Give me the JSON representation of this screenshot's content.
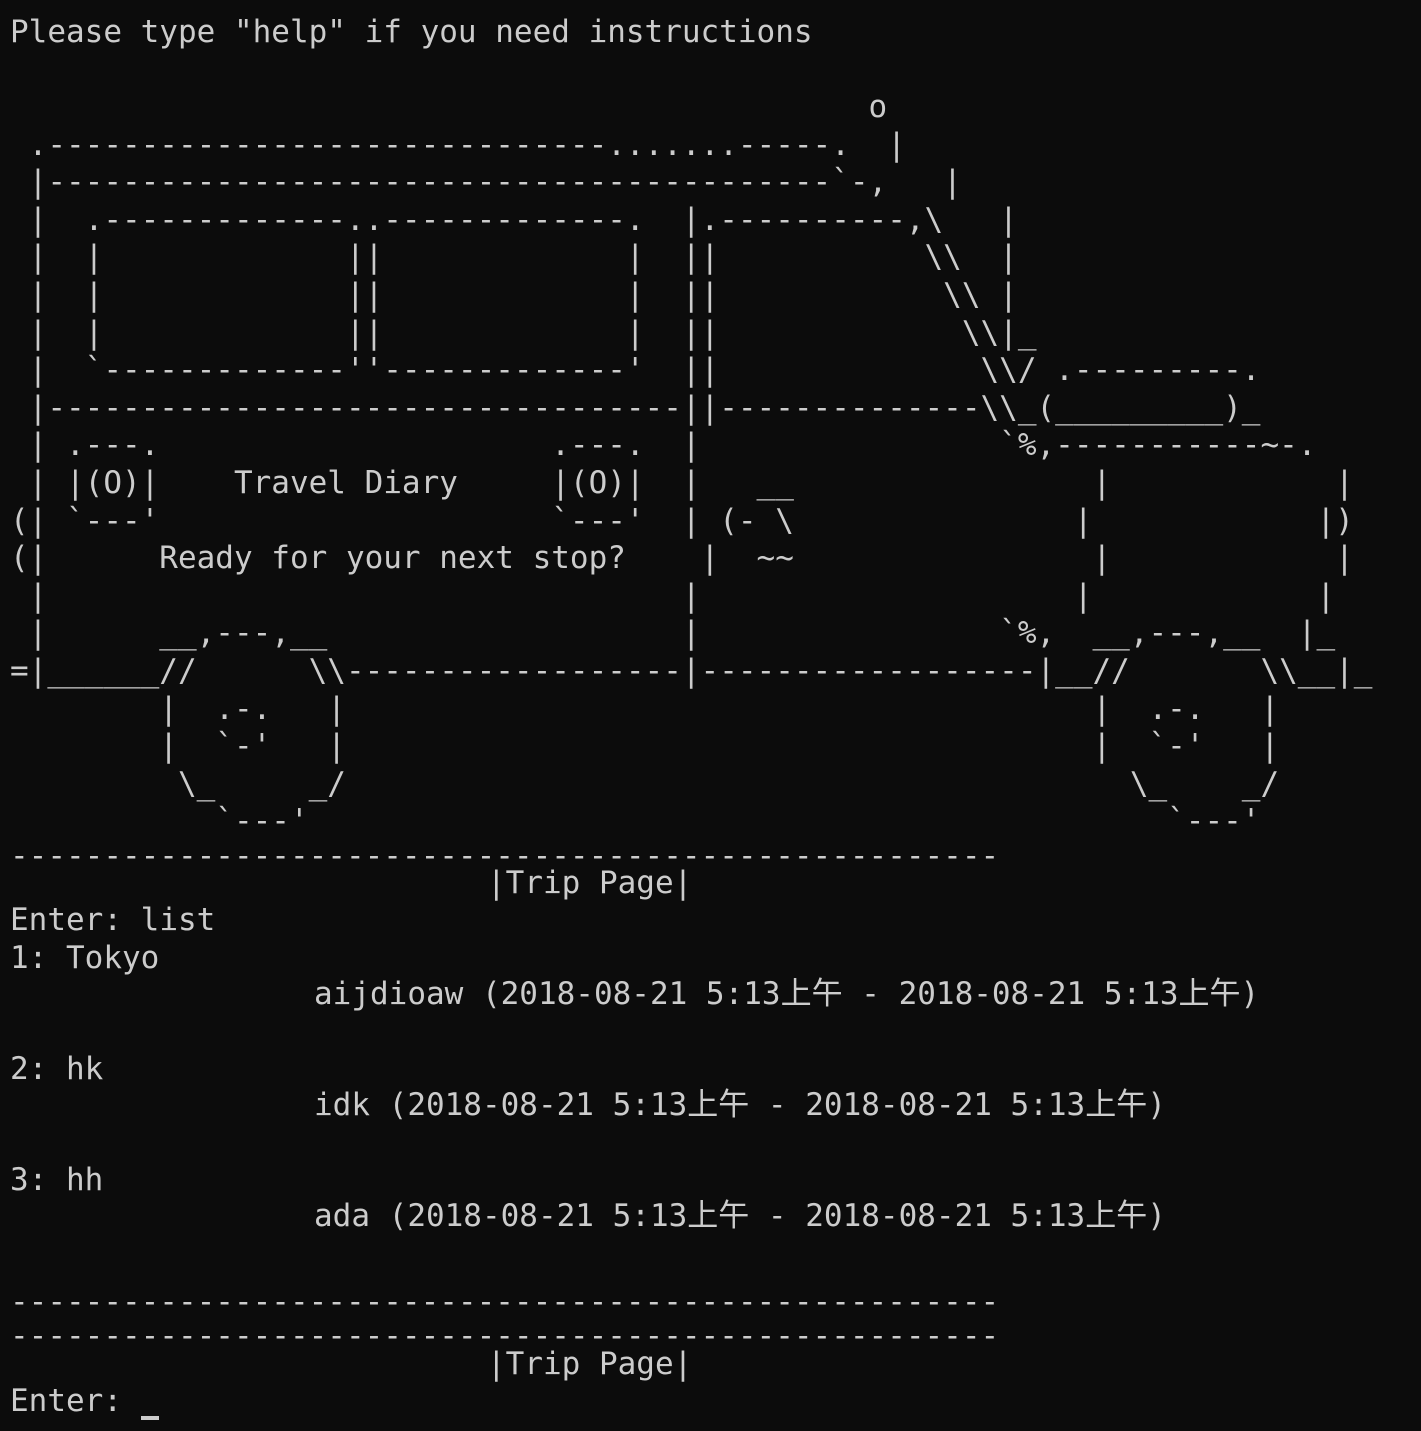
{
  "terminal": {
    "help_hint": "Please type \"help\" if you need instructions",
    "banner_lines": [
      "                                              o",
      " .------------------------------.......-----.  |",
      " |------------------------------------------`-,   |",
      " |  .-------------..-------------.  |.----------,\\   |",
      " |  |             ||             |  ||           \\\\  |",
      " |  |             ||             |  ||            \\\\ |",
      " |  |             ||             |  ||             \\\\|_",
      " |  `-------------''-------------'  ||              \\\\/ .---------.",
      " |----------------------------------||--------------\\\\_(_________)_",
      " | .---.                     .---.  |                `%,-----------~-.",
      " | |(O)|    Travel Diary     |(O)|  |   __                |            |",
      "(| `---'                     `---'  | (- \\               |            |)",
      "(|      Ready for your next stop?    |  ~~                |            |",
      " |                                  |                    |            |",
      " |      __,---,__                   |                `%,  __,---,__  |_",
      "=|______//      \\\\------------------|------------------|__//       \\\\__|_",
      "        |  .-.   |                                        |  .-.   |",
      "        |  `-'   |                                        |  `-'   |",
      "         \\_     _/                                          \\_    _/",
      "           `---'                                              `---'"
    ],
    "sections": [
      {
        "divider": "-----------------------------------------------------",
        "page_title": "|Trip Page|",
        "prompt": "Enter:",
        "command": "list",
        "trips": [
          {
            "heading": "1: Tokyo",
            "detail": "aijdioaw (2018-08-21 5:13上午 - 2018-08-21 5:13上午)"
          },
          {
            "heading": "2: hk",
            "detail": "idk (2018-08-21 5:13上午 - 2018-08-21 5:13上午)"
          },
          {
            "heading": "3: hh",
            "detail": "ada (2018-08-21 5:13上午 - 2018-08-21 5:13上午)"
          }
        ],
        "closing_divider": "-----------------------------------------------------"
      },
      {
        "divider": "-----------------------------------------------------",
        "page_title": "|Trip Page|",
        "prompt": "Enter:",
        "command": ""
      }
    ]
  },
  "colors": {
    "background": "#0c0c0c",
    "foreground": "#cccccc"
  }
}
